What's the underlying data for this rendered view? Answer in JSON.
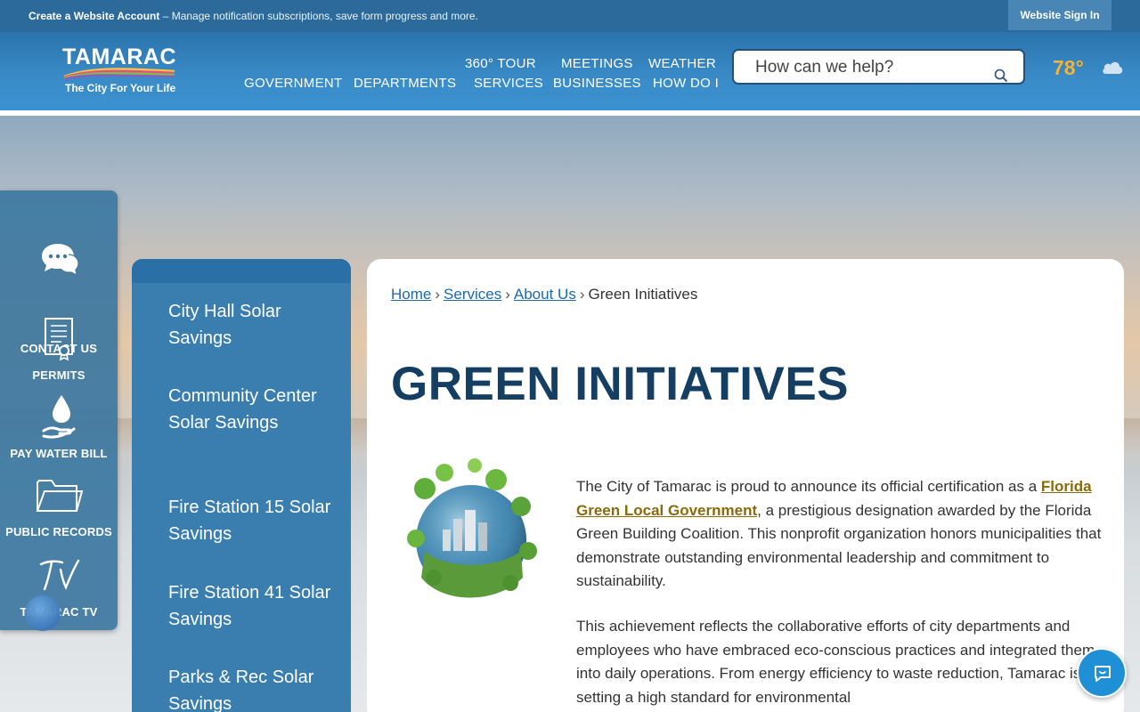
{
  "topbar": {
    "account_link": "Create a Website Account",
    "account_desc": " – Manage notification subscriptions, save form progress and more.",
    "signin": "Website Sign In"
  },
  "header": {
    "logo_name": "TAMARAC",
    "logo_tagline": "The City For Your Life",
    "nav": {
      "government": "GOVERNMENT",
      "departments": "DEPARTMENTS",
      "tour": "360° TOUR",
      "services": "SERVICES",
      "meetings": "MEETINGS",
      "businesses": "BUSINESSES",
      "weather": "WEATHER",
      "howdoi": "HOW DO I"
    },
    "search_placeholder": "How can we help?",
    "temperature": "78°",
    "weather_icon": "cloud-icon"
  },
  "quick_links": [
    {
      "label": "CONTACT US",
      "icon": "chat-bubbles-icon"
    },
    {
      "label": "PERMITS",
      "icon": "document-certificate-icon"
    },
    {
      "label": "PAY WATER BILL",
      "icon": "water-drop-hand-icon"
    },
    {
      "label": "PUBLIC RECORDS",
      "icon": "folder-icon"
    },
    {
      "label": "TAMARAC TV",
      "icon": "tv-script-icon"
    }
  ],
  "sidenav": {
    "items": [
      "City Hall Solar Savings",
      "Community Center Solar Savings",
      "Fire Station 15 Solar Savings",
      "Fire Station 41 Solar Savings",
      "Parks & Rec Solar Savings"
    ]
  },
  "content": {
    "breadcrumb": {
      "home": "Home",
      "services": "Services",
      "about": "About Us",
      "current": "Green Initiatives",
      "sep": "›"
    },
    "title": "GREEN INITIATIVES",
    "para1_a": "The City of Tamarac is proud to announce its official certification as a ",
    "para1_link": "Florida Green Local Government",
    "para1_b": ", a prestigious designation awarded by the Florida Green Building Coalition. This nonprofit organization honors municipalities that demonstrate outstanding environmental leadership and commitment to sustainability.",
    "para2": "This achievement reflects the collaborative efforts of city departments and employees who have embraced eco-conscious practices and integrated them into daily operations. From energy efficiency to waste reduction, Tamarac is setting a high standard for environmental"
  },
  "colors": {
    "header_blue": "#3a8cc8",
    "topbar_blue": "#2b6a9a",
    "title_navy": "#143f63",
    "accent_gold": "#f3b23a",
    "link_blue": "#1d6aa8"
  }
}
